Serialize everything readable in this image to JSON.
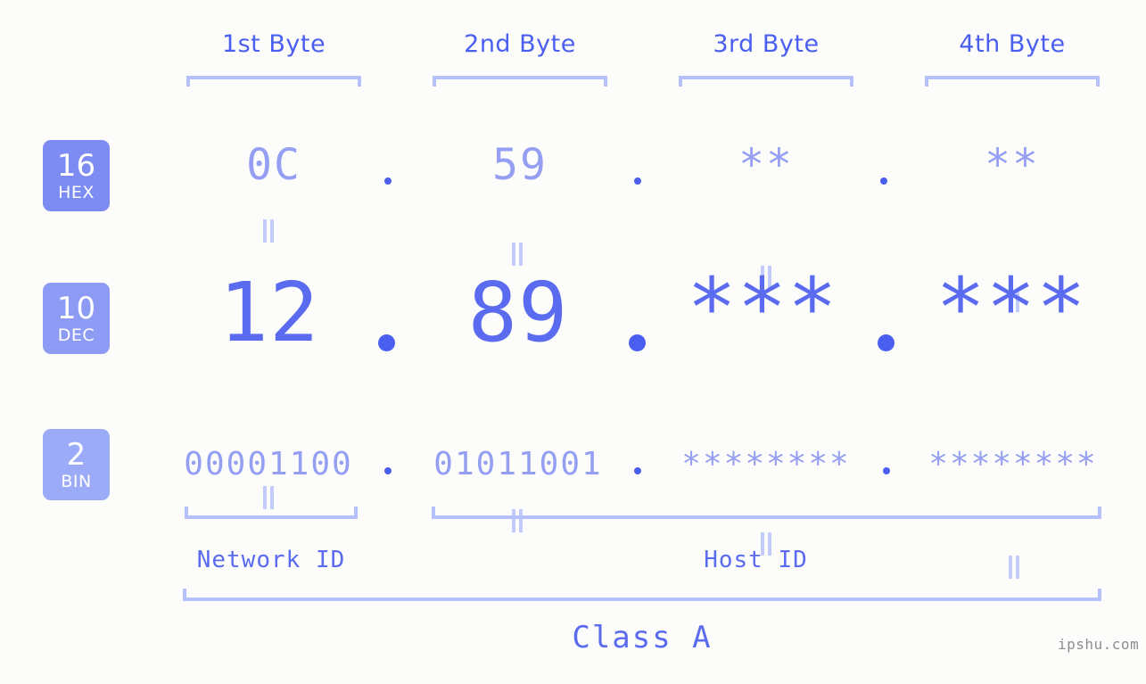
{
  "meta": {
    "site_watermark": "ipshu.com",
    "background_color": "#fcfdfa",
    "accent_strong": "#4a5ef0",
    "accent_mid": "#5a6bef",
    "accent_light": "#949ef2",
    "accent_bracket": "#b6c0fb"
  },
  "headers": {
    "byte1": "1st Byte",
    "byte2": "2nd Byte",
    "byte3": "3rd Byte",
    "byte4": "4th Byte"
  },
  "bases": [
    {
      "number": "16",
      "name": "HEX",
      "color": "#7d8cf2"
    },
    {
      "number": "10",
      "name": "DEC",
      "color": "#8d9bf4"
    },
    {
      "number": "2",
      "name": "BIN",
      "color": "#9cabf7"
    }
  ],
  "rows": {
    "hex": {
      "base_number": "16",
      "base_name": "HEX",
      "values": [
        "0C",
        "59",
        "**",
        "**"
      ],
      "separator": "."
    },
    "dec": {
      "base_number": "10",
      "base_name": "DEC",
      "values": [
        "12",
        "89",
        "***",
        "***"
      ],
      "separator": "."
    },
    "bin": {
      "base_number": "2",
      "base_name": "BIN",
      "values": [
        "00001100",
        "01011001",
        "********",
        "********"
      ],
      "separator": "."
    }
  },
  "equals_symbol": "=",
  "footer": {
    "network_id": "Network ID",
    "host_id": "Host ID",
    "class": "Class A"
  },
  "chart_data": {
    "type": "table",
    "title": "IPv4 Address Byte Breakdown - Class A",
    "columns": [
      "1st Byte",
      "2nd Byte",
      "3rd Byte",
      "4th Byte"
    ],
    "rows": [
      {
        "base": "HEX",
        "radix": 16,
        "values": [
          "0C",
          "59",
          "**",
          "**"
        ]
      },
      {
        "base": "DEC",
        "radix": 10,
        "values": [
          "12",
          "89",
          "***",
          "***"
        ]
      },
      {
        "base": "BIN",
        "radix": 2,
        "values": [
          "00001100",
          "01011001",
          "********",
          "********"
        ]
      }
    ],
    "network_id_bytes": [
      "1st Byte"
    ],
    "host_id_bytes": [
      "2nd Byte",
      "3rd Byte",
      "4th Byte"
    ],
    "address_class": "Class A"
  }
}
